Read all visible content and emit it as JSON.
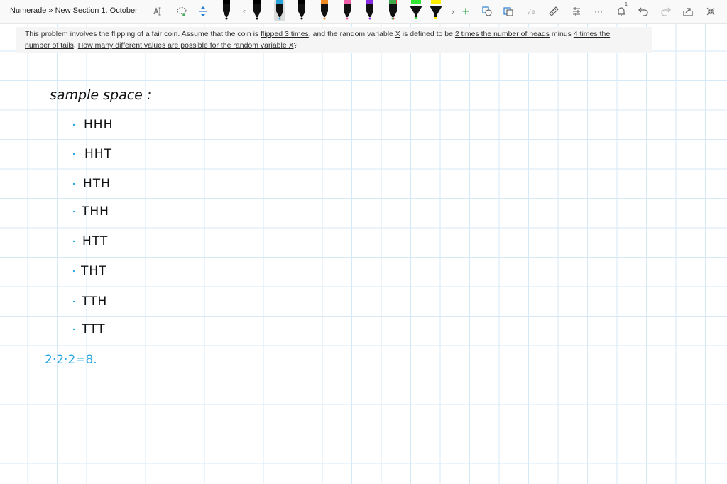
{
  "breadcrumb": {
    "notebook": "Numerade",
    "separator": "»",
    "section": "New Section 1. October"
  },
  "toolbar": {
    "tools": [
      {
        "name": "text-select-icon",
        "glyph": "A"
      },
      {
        "name": "lasso-select-icon",
        "glyph": "lasso"
      },
      {
        "name": "insert-space-icon",
        "glyph": "±"
      },
      {
        "name": "scroll-left-icon",
        "glyph": "‹"
      },
      {
        "name": "scroll-right-icon",
        "glyph": "›"
      },
      {
        "name": "add-pen-icon",
        "glyph": "+"
      }
    ],
    "pens": [
      {
        "name": "pen-black",
        "color": "#000000",
        "selected": false
      },
      {
        "name": "pen-black-2",
        "color": "#000000",
        "selected": false
      },
      {
        "name": "pen-light-blue",
        "color": "#29a3d9",
        "selected": true
      },
      {
        "name": "pen-black-3",
        "color": "#000000",
        "selected": false
      },
      {
        "name": "pen-orange",
        "color": "#f08a24",
        "selected": false
      },
      {
        "name": "pen-pink",
        "color": "#ef5fa7",
        "selected": false
      },
      {
        "name": "pen-purple",
        "color": "#8a2be2",
        "selected": false
      },
      {
        "name": "pen-red",
        "color": "#e8343a",
        "selected": false
      },
      {
        "name": "pen-green",
        "color": "#3ea84a",
        "selected": false
      },
      {
        "name": "highlighter-green",
        "color": "#33e633",
        "selected": false
      },
      {
        "name": "highlighter-yellow",
        "color": "#ffee00",
        "selected": false
      }
    ],
    "right_icons": [
      "ink-to-shape-icon",
      "ink-to-text-icon",
      "math-icon",
      "ruler-icon",
      "ink-options-icon",
      "more-icon",
      "bell-icon",
      "undo-icon",
      "redo-icon",
      "share-icon",
      "collapse-icon"
    ],
    "notification_count": "1",
    "more_label": "···"
  },
  "problem": {
    "p1": "This problem involves the flipping of a fair coin. Assume that the coin is ",
    "u1": "flipped 3 times",
    "p2": ", and the random variable ",
    "u2": "X",
    "p3": " is defined to be ",
    "u3": "2 times the number of heads",
    "p4": " minus ",
    "u4": "4 times the",
    "u5": "number of tails",
    "p5": ". ",
    "u6": "How many different values are possible for the random variable X",
    "p6": "?"
  },
  "notes": {
    "heading": "sample space :",
    "outcomes": [
      "HHH",
      "HHT",
      "HTH",
      "THH",
      "HTT",
      "THT",
      "TTH",
      "TTT"
    ],
    "count": "2·2·2=8."
  },
  "colors": {
    "ink": "#111111",
    "blue_ink": "#2aa7e0",
    "grid": "#d6e9f6"
  }
}
